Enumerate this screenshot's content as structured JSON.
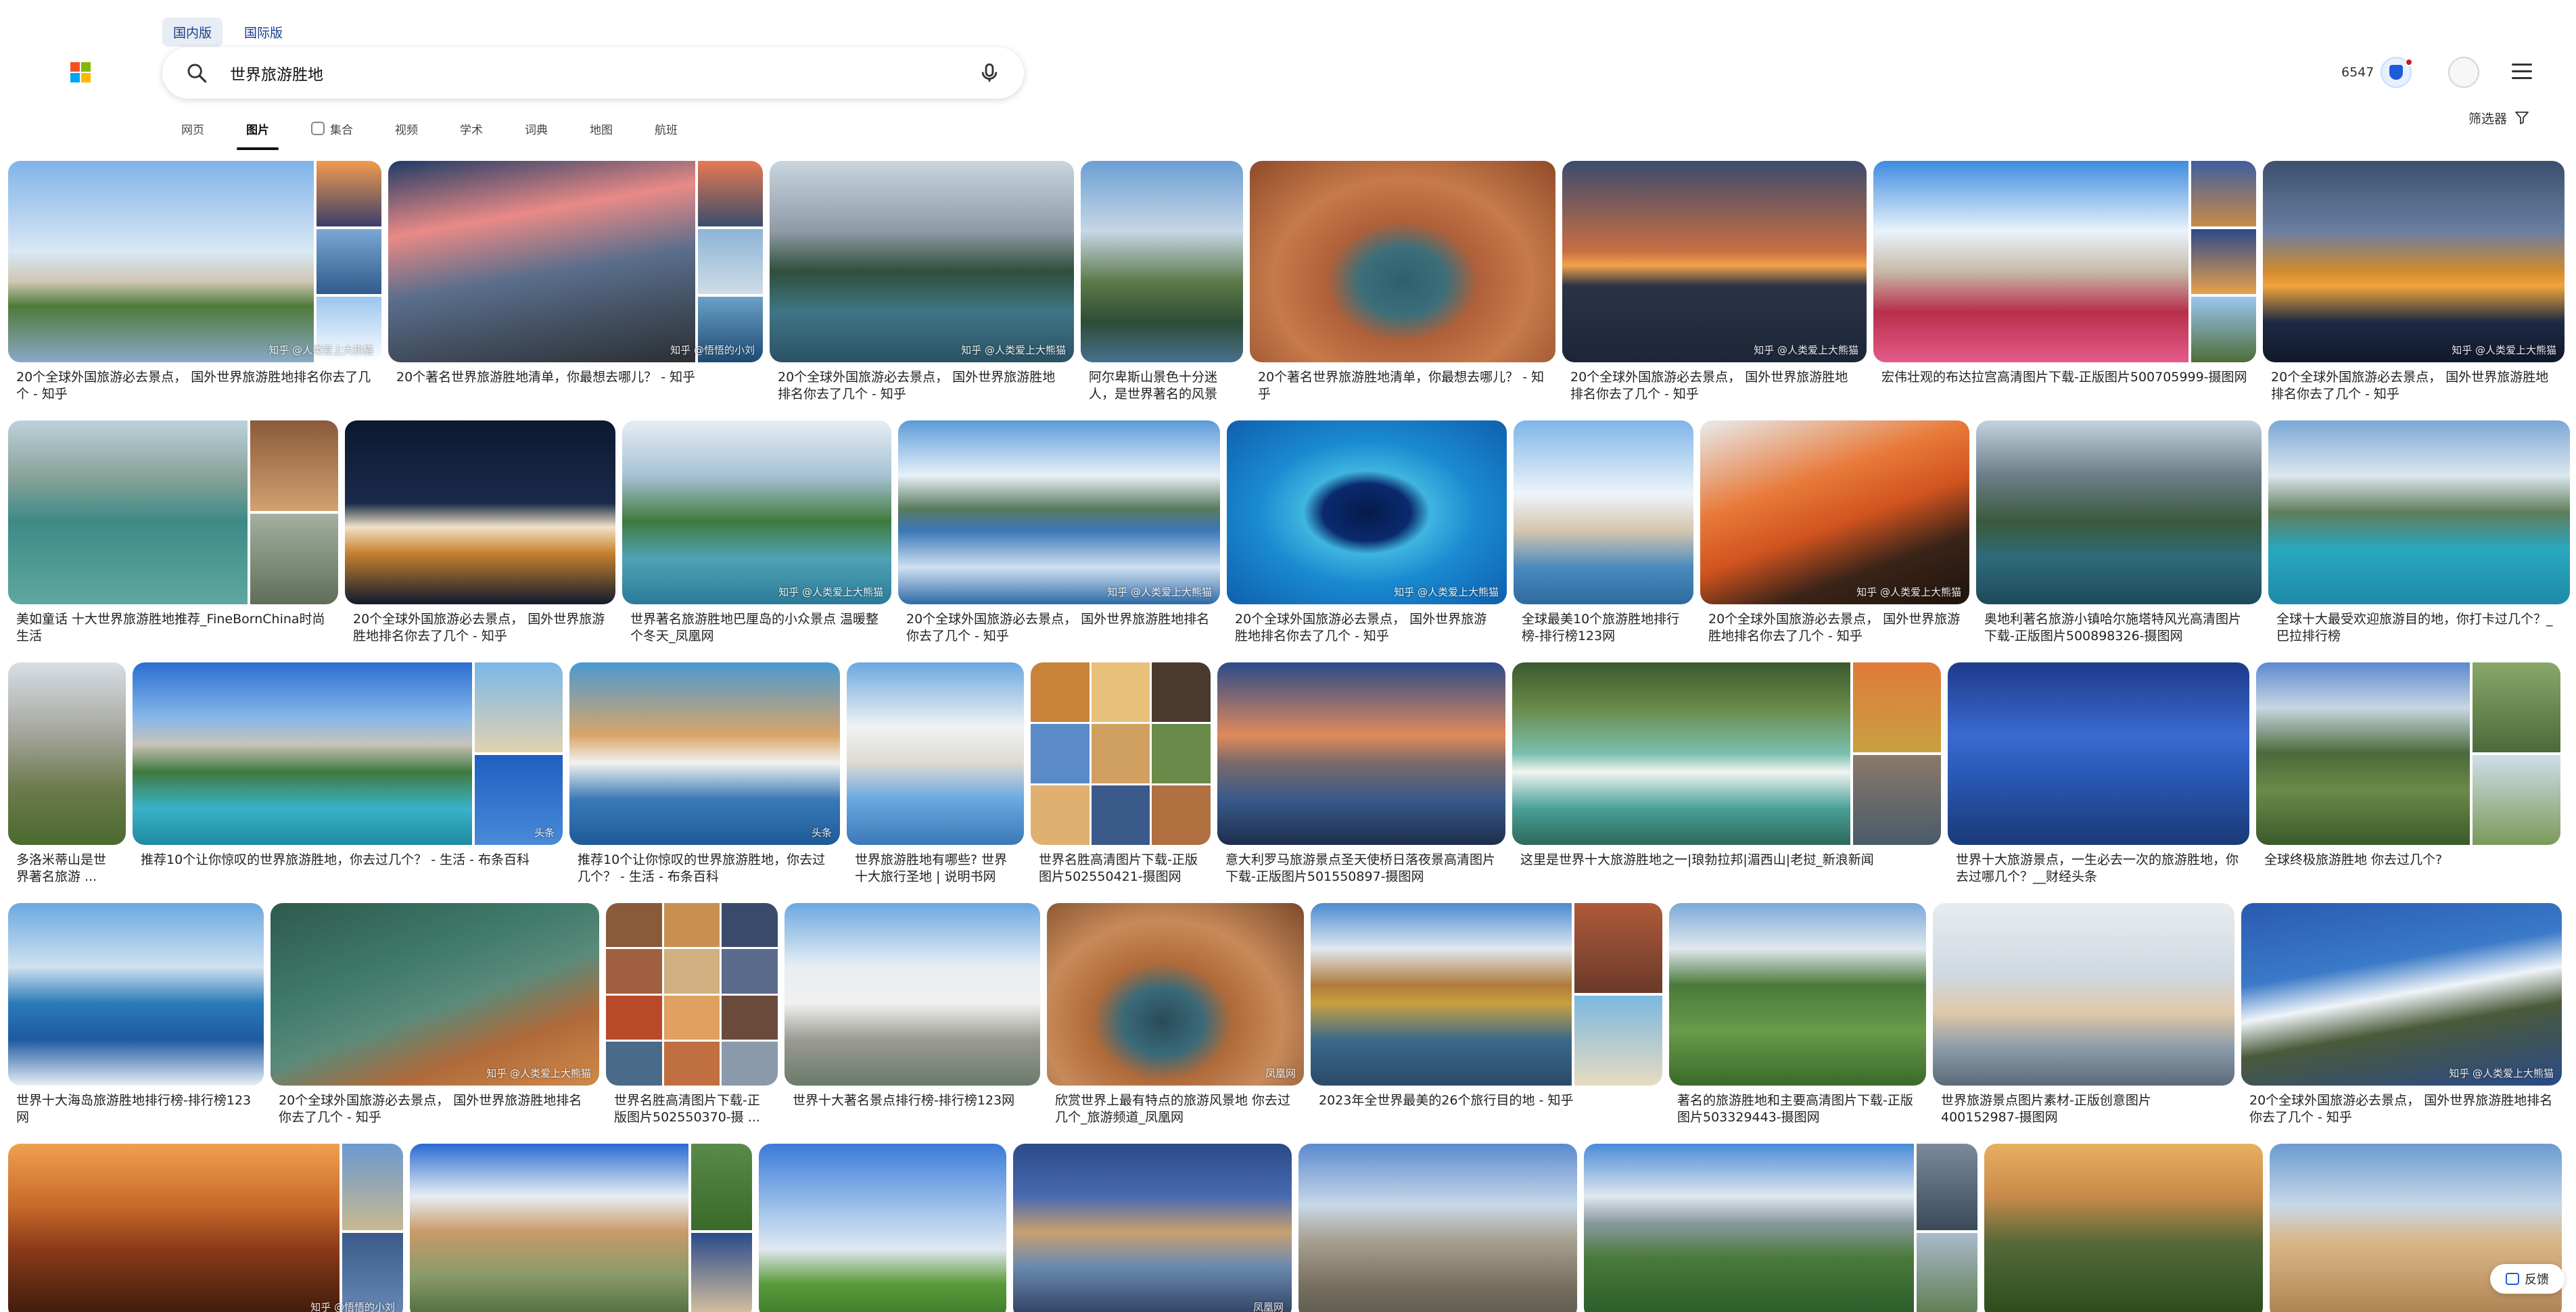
{
  "header": {
    "region_tabs": [
      "国内版",
      "国际版"
    ],
    "search": {
      "value": "世界旅游胜地",
      "icon": "search-icon",
      "mic": "mic-icon"
    },
    "points": "6547",
    "logo_colors": [
      "#f25022",
      "#7fba00",
      "#00a4ef",
      "#ffb900"
    ]
  },
  "nav": {
    "tabs": [
      "网页",
      "图片",
      "集合",
      "视频",
      "学术",
      "词典",
      "地图",
      "航班"
    ],
    "active": "图片",
    "filter_label": "筛选器"
  },
  "feedback_label": "反馈",
  "results": [
    [
      {
        "caption": "20个全球外国旅游必去景点， 国外世界旅游胜地排名你去了几个 - 知乎",
        "wm": "知乎 @人类爱上大热猫"
      },
      {
        "caption": "20个著名世界旅游胜地清单，你最想去哪儿？ - 知乎",
        "wm": "知乎 @悟悟的小刘"
      },
      {
        "caption": "20个全球外国旅游必去景点， 国外世界旅游胜地排名你去了几个 - 知乎",
        "wm": "知乎 @人类爱上大熊猫"
      },
      {
        "caption": "阿尔卑斯山景色十分迷人，是世界著名的风景",
        "wm": ""
      },
      {
        "caption": "20个著名世界旅游胜地清单，你最想去哪儿？ - 知乎",
        "wm": ""
      },
      {
        "caption": "20个全球外国旅游必去景点， 国外世界旅游胜地排名你去了几个 - 知乎",
        "wm": "知乎 @人类爱上大熊猫"
      },
      {
        "caption": "宏伟壮观的布达拉宫高清图片下载-正版图片500705999-摄图网",
        "wm": ""
      },
      {
        "caption": "20个全球外国旅游必去景点， 国外世界旅游胜地排名你去了几个 - 知乎",
        "wm": "知乎 @人类爱上大熊猫"
      }
    ],
    [
      {
        "caption": "美如童话 十大世界旅游胜地推荐_FineBornChina时尚生活",
        "wm": ""
      },
      {
        "caption": "20个全球外国旅游必去景点， 国外世界旅游胜地排名你去了几个 - 知乎",
        "wm": ""
      },
      {
        "caption": "世界著名旅游胜地巴厘岛的小众景点 温暖整个冬天_凤凰网",
        "wm": "知乎 @人类爱上大熊猫"
      },
      {
        "caption": "20个全球外国旅游必去景点， 国外世界旅游胜地排名你去了几个 - 知乎",
        "wm": "知乎 @人类爱上大熊猫"
      },
      {
        "caption": "20个全球外国旅游必去景点， 国外世界旅游胜地排名你去了几个 - 知乎",
        "wm": "知乎 @人类爱上大熊猫"
      },
      {
        "caption": "全球最美10个旅游胜地排行榜-排行榜123网",
        "wm": ""
      },
      {
        "caption": "20个全球外国旅游必去景点， 国外世界旅游胜地排名你去了几个 - 知乎",
        "wm": "知乎 @人类爱上大熊猫"
      },
      {
        "caption": "奥地利著名旅游小镇哈尔施塔特风光高清图片下载-正版图片500898326-摄图网",
        "wm": ""
      },
      {
        "caption": "全球十大最受欢迎旅游目的地，你打卡过几个？_巴拉排行榜",
        "wm": ""
      }
    ],
    [
      {
        "caption": "多洛米蒂山是世界著名旅游 ...",
        "wm": ""
      },
      {
        "caption": "推荐10个让你惊叹的世界旅游胜地，你去过几个？ - 生活 - 布条百科",
        "wm": "头条"
      },
      {
        "caption": "推荐10个让你惊叹的世界旅游胜地，你去过几个？ - 生活 - 布条百科",
        "wm": "头条"
      },
      {
        "caption": "世界旅游胜地有哪些? 世界十大旅行圣地 | 说明书网",
        "wm": ""
      },
      {
        "caption": "世界名胜高清图片下载-正版图片502550421-摄图网",
        "wm": ""
      },
      {
        "caption": "意大利罗马旅游景点圣天使桥日落夜景高清图片下载-正版图片501550897-摄图网",
        "wm": ""
      },
      {
        "caption": "这里是世界十大旅游胜地之一|琅勃拉邦|湄西山|老挝_新浪新闻",
        "wm": ""
      },
      {
        "caption": "世界十大旅游景点，一生必去一次的旅游胜地，你去过哪几个？__财经头条",
        "wm": ""
      },
      {
        "caption": "全球终极旅游胜地 你去过几个?",
        "wm": ""
      }
    ],
    [
      {
        "caption": "世界十大海岛旅游胜地排行榜-排行榜123网",
        "wm": ""
      },
      {
        "caption": "20个全球外国旅游必去景点， 国外世界旅游胜地排名你去了几个 - 知乎",
        "wm": "知乎 @人类爱上大熊猫"
      },
      {
        "caption": "世界名胜高清图片下载-正版图片502550370-摄 ...",
        "wm": ""
      },
      {
        "caption": "世界十大著名景点排行榜-排行榜123网",
        "wm": ""
      },
      {
        "caption": "欣赏世界上最有特点的旅游风景地 你去过几个_旅游频道_凤凰网",
        "wm": "凤凰网"
      },
      {
        "caption": "2023年全世界最美的26个旅行目的地 - 知乎",
        "wm": ""
      },
      {
        "caption": "著名的旅游胜地和主要高清图片下载-正版图片503329443-摄图网",
        "wm": ""
      },
      {
        "caption": "世界旅游景点图片素材-正版创意图片400152987-摄图网",
        "wm": ""
      },
      {
        "caption": "20个全球外国旅游必去景点， 国外世界旅游胜地排名你去了几个 - 知乎",
        "wm": "知乎 @人类爱上大熊猫"
      }
    ],
    [
      {
        "caption": "",
        "wm": "知乎 @悟悟的小刘"
      },
      {
        "caption": "",
        "wm": ""
      },
      {
        "caption": "",
        "wm": ""
      },
      {
        "caption": "",
        "wm": "凤凰网"
      },
      {
        "caption": "",
        "wm": ""
      },
      {
        "caption": "",
        "wm": ""
      },
      {
        "caption": "",
        "wm": ""
      },
      {
        "caption": "",
        "wm": ""
      }
    ]
  ]
}
